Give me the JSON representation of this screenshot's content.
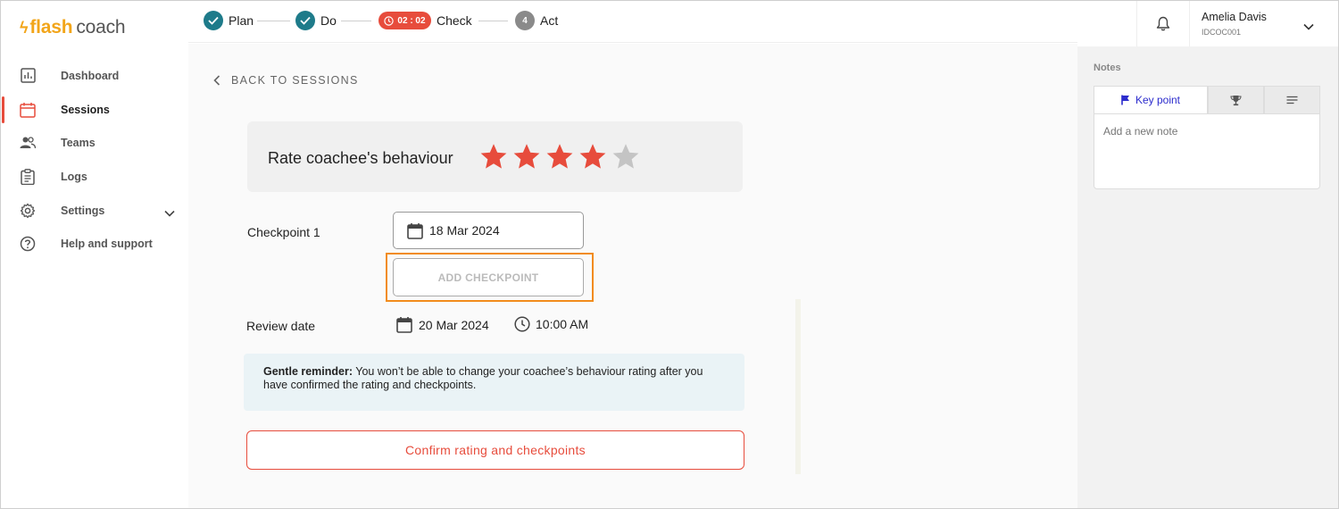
{
  "brand": {
    "part1": "flash",
    "part2": "coach"
  },
  "sidebar": {
    "items": [
      {
        "label": "Dashboard",
        "icon": "chart-icon"
      },
      {
        "label": "Sessions",
        "icon": "calendar-icon",
        "active": true
      },
      {
        "label": "Teams",
        "icon": "people-icon"
      },
      {
        "label": "Logs",
        "icon": "clipboard-icon"
      },
      {
        "label": "Settings",
        "icon": "gear-icon"
      },
      {
        "label": "Help and support",
        "icon": "help-icon"
      }
    ]
  },
  "steps": {
    "plan": "Plan",
    "do": "Do",
    "timer": "02 : 02",
    "check": "Check",
    "act_number": "4",
    "act": "Act"
  },
  "back_label": "BACK TO SESSIONS",
  "rating": {
    "title": "Rate coachee's behaviour",
    "value": 4,
    "max": 5,
    "filled_color": "#e74c3c",
    "empty_color": "#c4c4c4"
  },
  "checkpoint": {
    "label": "Checkpoint 1",
    "date": "18 Mar 2024",
    "add_label": "ADD CHECKPOINT"
  },
  "review": {
    "label": "Review date",
    "date": "20 Mar 2024",
    "time": "10:00 AM"
  },
  "reminder": {
    "bold": "Gentle reminder:",
    "text": " You won’t be able to change your coachee’s behaviour rating after you have confirmed the rating and checkpoints."
  },
  "confirm_label": "Confirm rating and checkpoints",
  "user": {
    "name": "Amelia Davis",
    "id": "IDCOC001"
  },
  "notes": {
    "heading": "Notes",
    "tab_key_point": "Key point",
    "placeholder": "Add a new note"
  },
  "colors": {
    "accent": "#e74c3c",
    "teal": "#1e7b8a",
    "highlight": "#f28c1c",
    "link_blue": "#2c2ccd"
  }
}
